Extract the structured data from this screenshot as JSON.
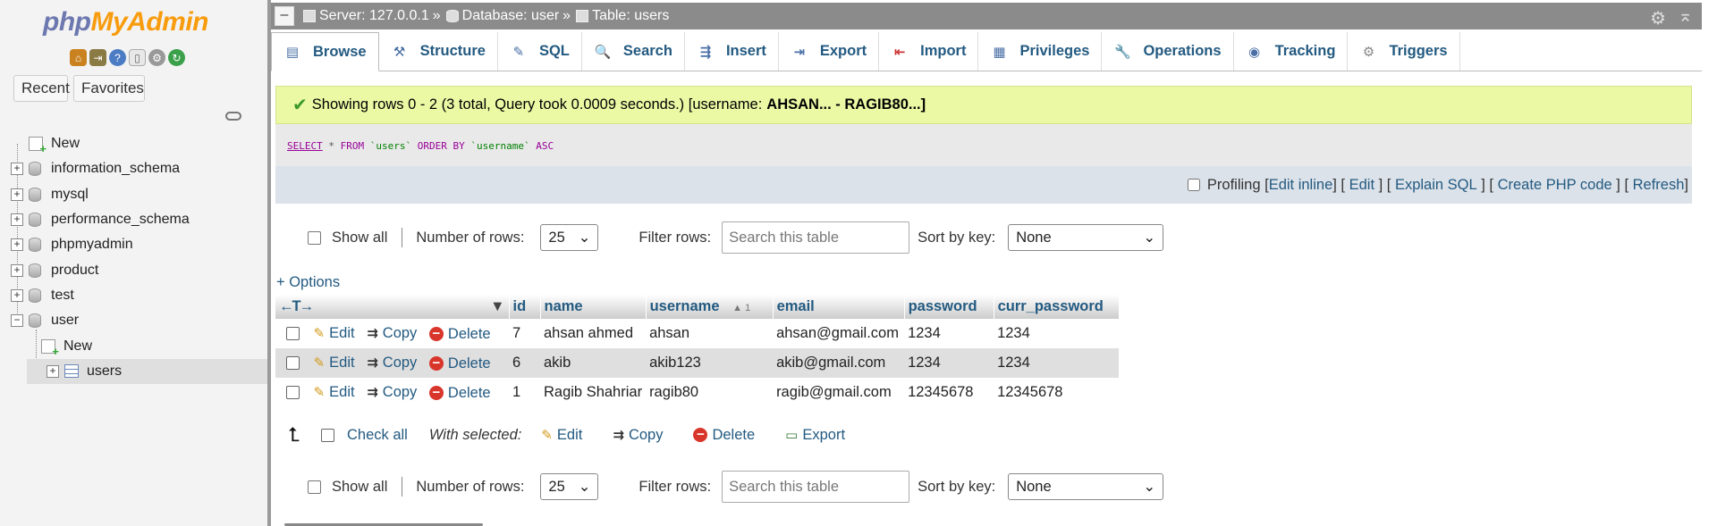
{
  "sidebar": {
    "logo_php": "php",
    "logo_admin": "MyAdmin",
    "recent_label": "Recent",
    "favorites_label": "Favorites",
    "tree": [
      {
        "label": "New",
        "type": "new"
      },
      {
        "label": "information_schema",
        "type": "db"
      },
      {
        "label": "mysql",
        "type": "db"
      },
      {
        "label": "performance_schema",
        "type": "db"
      },
      {
        "label": "phpmyadmin",
        "type": "db"
      },
      {
        "label": "product",
        "type": "db"
      },
      {
        "label": "test",
        "type": "db"
      },
      {
        "label": "user",
        "type": "db-open"
      },
      {
        "label": "New",
        "type": "child-new"
      },
      {
        "label": "users",
        "type": "child-table"
      }
    ]
  },
  "breadcrumb": {
    "server": "Server: 127.0.0.1",
    "database": "Database: user",
    "table": "Table: users",
    "separator": "»"
  },
  "tabs": [
    {
      "label": "Browse",
      "icon": "browse-icon",
      "glyph": "▤"
    },
    {
      "label": "Structure",
      "icon": "structure-icon",
      "glyph": "⚒"
    },
    {
      "label": "SQL",
      "icon": "sql-icon",
      "glyph": "✎"
    },
    {
      "label": "Search",
      "icon": "search-icon",
      "glyph": "🔍"
    },
    {
      "label": "Insert",
      "icon": "insert-icon",
      "glyph": "⇶"
    },
    {
      "label": "Export",
      "icon": "export-icon",
      "glyph": "⇥"
    },
    {
      "label": "Import",
      "icon": "import-icon",
      "glyph": "⇤"
    },
    {
      "label": "Privileges",
      "icon": "privileges-icon",
      "glyph": "▦"
    },
    {
      "label": "Operations",
      "icon": "wrench-icon",
      "glyph": "🔧"
    },
    {
      "label": "Tracking",
      "icon": "eye-icon",
      "glyph": "◉"
    },
    {
      "label": "Triggers",
      "icon": "triggers-icon",
      "glyph": "⚙"
    }
  ],
  "success": {
    "text": "Showing rows 0 - 2 (3 total, Query took 0.0009 seconds.) [username:",
    "bold": "AHSAN... - RAGIB80...]"
  },
  "sql": {
    "select": "SELECT",
    "star": "*",
    "from": "FROM",
    "table": "`users`",
    "order": "ORDER BY",
    "col": "`username`",
    "dir": "ASC"
  },
  "sqltools": {
    "profiling": "Profiling",
    "edit_inline": "Edit inline",
    "edit": "Edit",
    "explain": "Explain SQL",
    "create_php": "Create PHP code",
    "refresh": "Refresh"
  },
  "nav": {
    "show_all": "Show all",
    "rows_label": "Number of rows:",
    "rows_value": "25",
    "filter_label": "Filter rows:",
    "filter_placeholder": "Search this table",
    "sort_label": "Sort by key:",
    "sort_value": "None"
  },
  "options_label": "+ Options",
  "table": {
    "columns": [
      "id",
      "name",
      "username",
      "email",
      "password",
      "curr_password"
    ],
    "sort_indicator": "▲ 1",
    "rows": [
      [
        "7",
        "ahsan ahmed",
        "ahsan",
        "ahsan@gmail.com",
        "1234",
        "1234"
      ],
      [
        "6",
        "akib",
        "akib123",
        "akib@gmail.com",
        "1234",
        "1234"
      ],
      [
        "1",
        "Ragib Shahriar",
        "ragib80",
        "ragib@gmail.com",
        "12345678",
        "12345678"
      ]
    ],
    "edit_label": "Edit",
    "copy_label": "Copy",
    "delete_label": "Delete"
  },
  "with_selected": {
    "check_all": "Check all",
    "label": "With selected:",
    "edit": "Edit",
    "copy": "Copy",
    "delete": "Delete",
    "export": "Export"
  }
}
